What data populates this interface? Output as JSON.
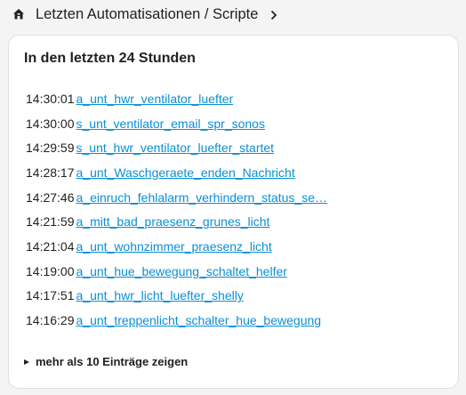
{
  "header": {
    "title": "Letzten Automatisationen / Scripte",
    "home_icon": "home-icon",
    "chevron_icon": "chevron-right-icon"
  },
  "card": {
    "title": "In den letzten 24 Stunden",
    "entries": [
      {
        "time": "14:30:01",
        "name": "a_unt_hwr_ventilator_luefter"
      },
      {
        "time": "14:30:00",
        "name": "s_unt_ventilator_email_spr_sonos"
      },
      {
        "time": "14:29:59",
        "name": "s_unt_hwr_ventilator_luefter_startet"
      },
      {
        "time": "14:28:17",
        "name": "a_unt_Waschgeraete_enden_Nachricht"
      },
      {
        "time": "14:27:46",
        "name": "a_einruch_fehlalarm_verhindern_status_se…"
      },
      {
        "time": "14:21:59",
        "name": "a_mitt_bad_praesenz_grunes_licht"
      },
      {
        "time": "14:21:04",
        "name": "a_unt_wohnzimmer_praesenz_licht"
      },
      {
        "time": "14:19:00",
        "name": "a_unt_hue_bewegung_schaltet_helfer"
      },
      {
        "time": "14:17:51",
        "name": "a_unt_hwr_licht_luefter_shelly"
      },
      {
        "time": "14:16:29",
        "name": "a_unt_treppenlicht_schalter_hue_bewegung"
      }
    ],
    "more_label": "mehr als 10 Einträge zeigen"
  },
  "colors": {
    "link": "#0a8fd4",
    "text": "#212121",
    "background": "#f4f4f4",
    "card": "#ffffff"
  }
}
